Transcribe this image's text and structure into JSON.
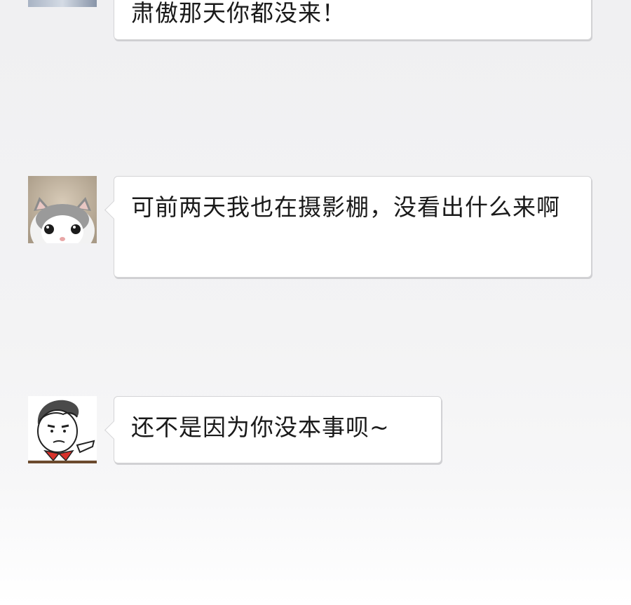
{
  "messages": [
    {
      "text": "肃傲那天你都没来！",
      "avatar": "partial-avatar"
    },
    {
      "text": "可前两天我也在摄影棚，没看出什么来啊",
      "avatar": "kitten-avatar"
    },
    {
      "text": "还不是因为你没本事呗~",
      "avatar": "cartoon-man-avatar"
    }
  ]
}
